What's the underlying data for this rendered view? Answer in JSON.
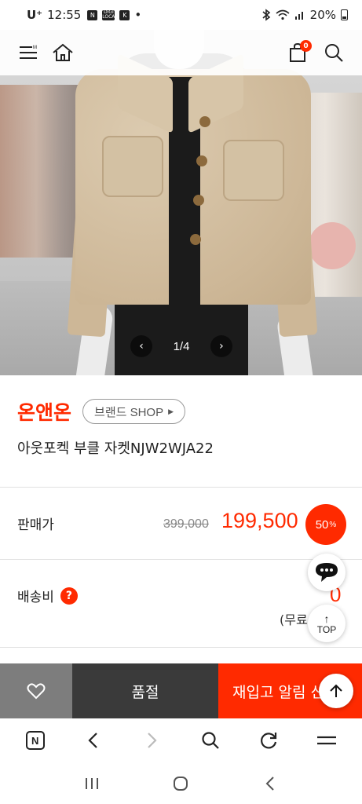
{
  "status_bar": {
    "carrier": "U⁺",
    "time": "12:55",
    "notif_1": "N",
    "notif_2": "DIGI LOCA",
    "notif_3": "K",
    "dot": "•",
    "battery_percent": "20%"
  },
  "header": {
    "menu_icon": "menu-icon",
    "home_icon": "home-icon",
    "cart_icon": "shopping-bag-icon",
    "cart_count": "0",
    "search_icon": "search-icon"
  },
  "gallery": {
    "prev_symbol": "‹",
    "next_symbol": "›",
    "counter": "1/4",
    "current": 1,
    "total": 4
  },
  "product": {
    "brand": "온앤온",
    "brand_shop_label": "브랜드 SHOP",
    "name": "아웃포켁 부클 자켓NJW2WJA22"
  },
  "price": {
    "label": "판매가",
    "original": "399,000",
    "sale": "199,500",
    "discount_value": "50",
    "discount_unit": "%"
  },
  "shipping": {
    "label": "배송비",
    "help_symbol": "?",
    "value": "0",
    "note": "(무료"
  },
  "floating": {
    "chat_icon": "chat-bubble-icon",
    "top_label": "TOP",
    "top_arrow": "↑"
  },
  "actions": {
    "wish_icon": "heart-icon",
    "soldout_label": "품절",
    "restock_label": "재입고 알림 신"
  },
  "browser": {
    "n_label": "N",
    "icons": [
      "n-home-icon",
      "back-icon",
      "forward-icon",
      "search-icon",
      "refresh-icon",
      "menu-icon"
    ]
  },
  "system_nav": {
    "icons": [
      "recent-apps-icon",
      "home-icon",
      "back-icon"
    ]
  },
  "colors": {
    "accent": "#ff2a00",
    "dark_button": "#3a3a3a",
    "grey_button": "#7d7d7d"
  }
}
